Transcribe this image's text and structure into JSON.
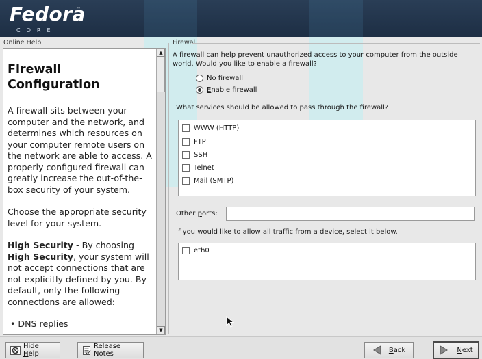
{
  "header": {
    "logo": "Fedora",
    "logo_tm": "™",
    "logo_sub": "CORE"
  },
  "help": {
    "label": "Online Help",
    "title": "Firewall Configuration",
    "para1": "A firewall sits between your computer and the network, and determines which resources on your computer remote users on the network are able to access. A properly configured firewall can greatly increase the out-of-the-box security of your system.",
    "para2": "Choose the appropriate security level for your system.",
    "para3_bold1": "High Security",
    "para3_mid": " - By choosing ",
    "para3_bold2": "High Security",
    "para3_rest": ", your system will not accept connections that are not explicitly defined by you. By default, only the following connections are allowed:",
    "bullet1": "• DNS replies"
  },
  "firewall": {
    "group_label": "Firewall",
    "intro": "A firewall can help prevent unauthorized access to your computer from the outside world.  Would you like to enable a firewall?",
    "options": [
      {
        "pre": "N",
        "u": "o",
        "post": " firewall",
        "selected": false
      },
      {
        "pre": "",
        "u": "E",
        "post": "nable firewall",
        "selected": true
      }
    ],
    "services_question": "What services should be allowed to pass through the firewall?",
    "services": [
      {
        "label": "WWW (HTTP)",
        "checked": false
      },
      {
        "label": "FTP",
        "checked": false
      },
      {
        "label": "SSH",
        "checked": false
      },
      {
        "label": "Telnet",
        "checked": false
      },
      {
        "label": "Mail (SMTP)",
        "checked": false
      }
    ],
    "other_ports_pre": "Other ",
    "other_ports_u": "p",
    "other_ports_post": "orts:",
    "other_ports_value": "",
    "devices_question": "If you would like to allow all traffic from a device, select it below.",
    "devices": [
      {
        "label": "eth0",
        "checked": false
      }
    ]
  },
  "buttons": {
    "hide_help_pre": "Hide ",
    "hide_help_u": "H",
    "hide_help_post": "elp",
    "release_notes_u": "R",
    "release_notes_post": "elease Notes",
    "back_u": "B",
    "back_post": "ack",
    "next_u": "N",
    "next_post": "ext"
  }
}
